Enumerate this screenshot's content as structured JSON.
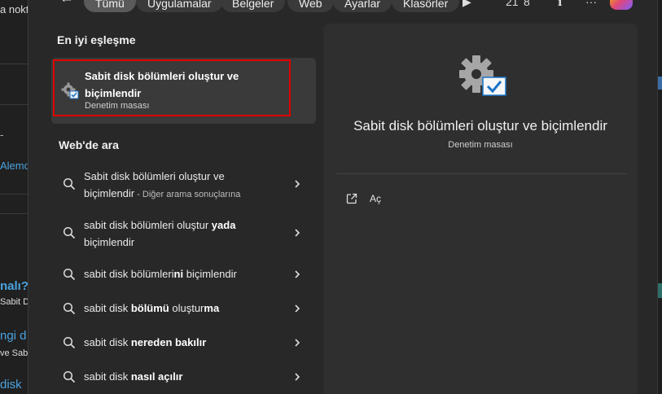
{
  "background": {
    "left_fragments": [
      "a nokt",
      "Alemo",
      "nalı?",
      "Sabit D",
      "ngi d",
      "ve Sabi",
      "disk"
    ]
  },
  "tabs": [
    {
      "label": "Tümü",
      "active": true
    },
    {
      "label": "Uygulamalar",
      "active": false
    },
    {
      "label": "Belgeler",
      "active": false
    },
    {
      "label": "Web",
      "active": false
    },
    {
      "label": "Ayarlar",
      "active": false
    },
    {
      "label": "Klasörler",
      "active": false
    }
  ],
  "top_bar": {
    "count": "21"
  },
  "best_match": {
    "section_title": "En iyi eşleşme",
    "title": "Sabit disk bölümleri oluştur ve biçimlendir",
    "subtitle": "Denetim masası"
  },
  "web_search": {
    "section_title": "Web'de ara",
    "items": [
      {
        "line1": "Sabit disk bölümleri oluştur ve",
        "line2": "biçimlendir",
        "suffix": " - Diğer arama sonuçlarına"
      },
      {
        "pre": "sabit disk bölümleri oluştur ",
        "bold": "yada",
        "line2": "biçimlendir"
      },
      {
        "pre": "sabit disk bölümleri",
        "bold": "ni",
        "post": " biçimlendir"
      },
      {
        "pre": "sabit disk ",
        "bold": "bölümü",
        "post": " oluştur",
        "bold2": "ma"
      },
      {
        "pre": "sabit disk ",
        "bold": "nereden bakılır"
      },
      {
        "pre": "sabit disk ",
        "bold": "nasıl açılır"
      }
    ]
  },
  "detail": {
    "title": "Sabit disk bölümleri oluştur ve biçimlendir",
    "subtitle": "Denetim masası",
    "open_label": "Aç"
  }
}
